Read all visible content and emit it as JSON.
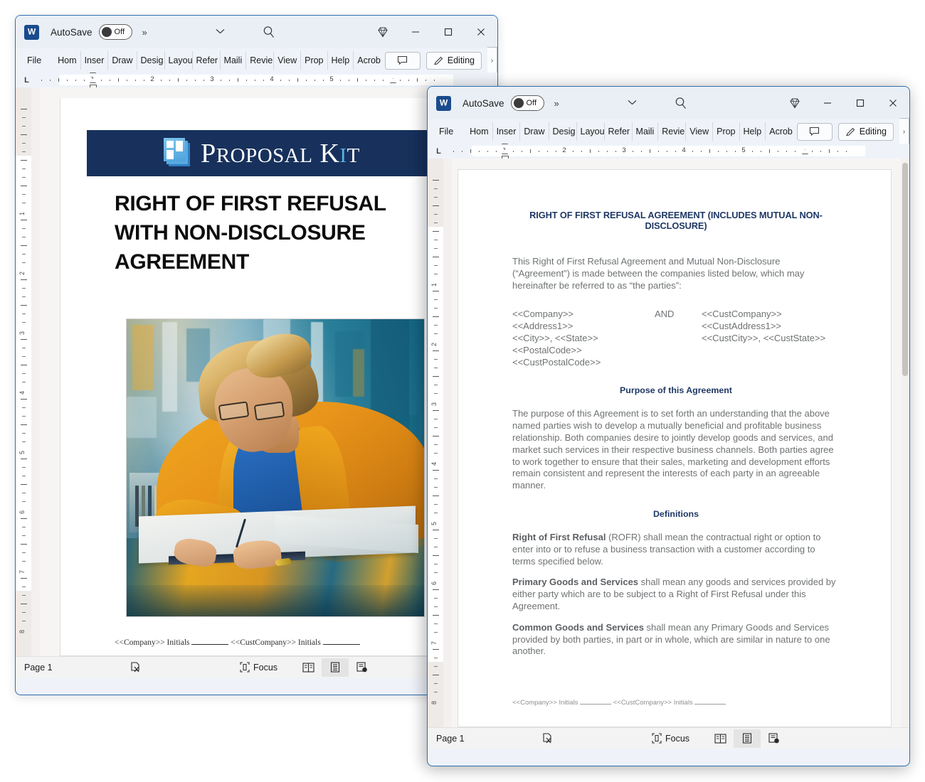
{
  "app": {
    "name": "Microsoft Word",
    "icon_letter": "W",
    "autosave_label": "AutoSave",
    "autosave_state": "Off",
    "more_label": "»",
    "caret_label": "∨"
  },
  "titlebar_buttons": [
    {
      "name": "diamond-icon",
      "label": ""
    },
    {
      "name": "minimize-button",
      "label": "–"
    },
    {
      "name": "maximize-button",
      "label": "□"
    },
    {
      "name": "close-button",
      "label": "✕"
    }
  ],
  "ribbon": {
    "tabs": [
      "File",
      "Home",
      "Insert",
      "Draw",
      "Design",
      "Layout",
      "References",
      "Mailings",
      "Review",
      "View",
      "Properties",
      "Help",
      "Acrobat"
    ],
    "tabs_visible": [
      "File",
      "Hom",
      "Inser",
      "Draw",
      "Desig",
      "Layou",
      "Refer",
      "Maili",
      "Revie",
      "View",
      "Prop",
      "Help",
      "Acrob"
    ],
    "comment_button": "",
    "editing_button": "Editing",
    "overflow_arrow": "›"
  },
  "ruler": {
    "horizontal_numbers": [
      "1",
      "2",
      "3",
      "4",
      "5"
    ],
    "vertical_numbers": [
      "1",
      "2",
      "3",
      "4",
      "5",
      "6",
      "7",
      "8"
    ],
    "tab_stop_marker": "L"
  },
  "statusbar": {
    "page_label": "Page 1",
    "proofing_icon": "spelling-check-icon",
    "focus_label": "Focus",
    "views": [
      {
        "name": "read-mode-view-button",
        "active": false
      },
      {
        "name": "print-layout-view-button",
        "active": true
      },
      {
        "name": "web-layout-view-button",
        "active": false
      }
    ]
  },
  "window_back": {
    "document": {
      "banner_brand": "Proposal Kit",
      "banner_brand_parts": {
        "p": "P",
        "roposal": "ROPOSAL",
        "k": "K",
        "i": "I",
        "t": "T"
      },
      "banner_color": "#17315c",
      "title_lines": [
        "RIGHT OF FIRST REFUSAL",
        "WITH NON-DISCLOSURE",
        "AGREEMENT"
      ],
      "cover_image_alt": "Painted illustration of a businesswoman in an orange blazer writing on documents at a desk",
      "footer": {
        "company_token": "<<Company>>",
        "company_initials_label": "Initials",
        "cust_company_token": "<<CustCompany>>",
        "cust_initials_label": "Initials"
      }
    }
  },
  "window_front": {
    "document": {
      "title": "RIGHT OF FIRST REFUSAL AGREEMENT (INCLUDES MUTUAL NON-DISCLOSURE)",
      "intro": "This Right of First Refusal Agreement and Mutual Non-Disclosure (“Agreement”) is made between the companies listed below, which may hereinafter be referred to as “the parties”:",
      "parties": {
        "left": [
          "<<Company>>",
          "<<Address1>>",
          "<<City>>, <<State>> <<PostalCode>>"
        ],
        "conjunction": "AND",
        "right": [
          "<<CustCompany>>",
          "<<CustAddress1>>",
          "<<CustCity>>, <<CustState>>"
        ],
        "left_overflow": "<<CustPostalCode>>"
      },
      "purpose_heading": "Purpose of this Agreement",
      "purpose_body": "The purpose of this Agreement is to set forth an understanding that the above named parties wish to develop a mutually beneficial and profitable business relationship. Both companies desire to jointly develop goods and services, and market such services in their respective business channels. Both parties agree to work together to ensure that their sales, marketing and development efforts remain consistent and represent the interests of each party in an agreeable manner.",
      "definitions_heading": "Definitions",
      "definitions": [
        {
          "term": "Right of First Refusal",
          "body": " (ROFR) shall mean the contractual right or option to enter into or to refuse a business transaction with a customer according to terms specified below."
        },
        {
          "term": "Primary Goods and Services",
          "body": " shall mean any goods and services provided by either party which are to be subject to a Right of First Refusal under this Agreement."
        },
        {
          "term": "Common Goods and Services",
          "body": " shall mean any Primary Goods and Services provided by both parties, in part or in whole, which are similar in nature to one another."
        }
      ],
      "footer": {
        "company_token": "<<Company>>",
        "company_initials_label": "Initials",
        "cust_company_token": "<<CustCompany>>",
        "cust_initials_label": "Initials"
      }
    }
  },
  "colors": {
    "window_border": "#2f6fb0",
    "titlebar_bg": "#eaeff6",
    "ribbon_bg": "#eff3f9",
    "doc_heading": "#1f3864",
    "doc_body": "#6f7274",
    "banner_navy": "#17315c",
    "word_blue": "#1a4b8c"
  }
}
